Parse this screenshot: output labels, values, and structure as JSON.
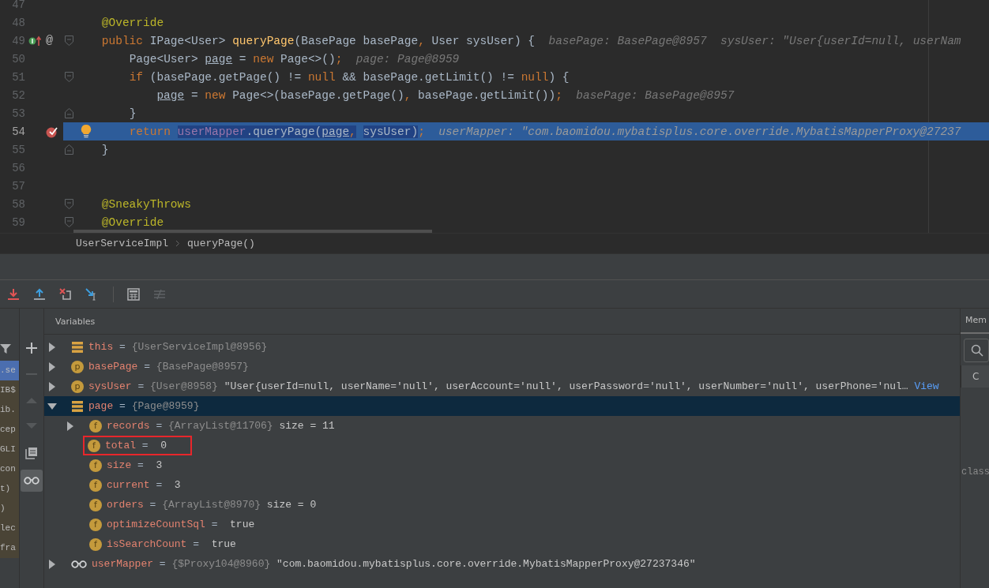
{
  "editor": {
    "lines": [
      {
        "number": "47",
        "current": false
      },
      {
        "number": "48",
        "current": false,
        "tokens": [
          {
            "t": "    @Override",
            "kind": "ann"
          }
        ]
      },
      {
        "number": "49",
        "current": false,
        "implements": true,
        "gutter_text": "@",
        "fold_start": true,
        "tokens": [
          {
            "t": "    public",
            "kind": "kw"
          },
          {
            "t": " IPage<User> ",
            "kind": "plain"
          },
          {
            "t": "queryPage",
            "kind": "fn"
          },
          {
            "t": "(BasePage basePage",
            "kind": "plain"
          },
          {
            "t": ",",
            "kind": "kw"
          },
          {
            "t": " User sysUser) {",
            "kind": "plain"
          },
          {
            "t": "basePage: BasePage@8957  sysUser: \"User{userId=null, userNam",
            "kind": "hint"
          }
        ]
      },
      {
        "number": "50",
        "current": false,
        "tokens": [
          {
            "t": "        Page<User> ",
            "kind": "plain"
          },
          {
            "t": "page",
            "kind": "var"
          },
          {
            "t": " = ",
            "kind": "plain"
          },
          {
            "t": "new",
            "kind": "kw"
          },
          {
            "t": " Page<>()",
            "kind": "plain"
          },
          {
            "t": ";",
            "kind": "kw"
          },
          {
            "t": "page: Page@8959",
            "kind": "hint"
          }
        ]
      },
      {
        "number": "51",
        "current": false,
        "fold_start": true,
        "tokens": [
          {
            "t": "        if",
            "kind": "kw"
          },
          {
            "t": " (basePage.getPage() != ",
            "kind": "plain"
          },
          {
            "t": "null",
            "kind": "kw"
          },
          {
            "t": " && basePage.getLimit() != ",
            "kind": "plain"
          },
          {
            "t": "null",
            "kind": "kw"
          },
          {
            "t": ") {",
            "kind": "plain"
          }
        ]
      },
      {
        "number": "52",
        "current": false,
        "tokens": [
          {
            "t": "            page",
            "kind": "var"
          },
          {
            "t": " = ",
            "kind": "plain"
          },
          {
            "t": "new",
            "kind": "kw"
          },
          {
            "t": " Page<>(basePage.getPage()",
            "kind": "plain"
          },
          {
            "t": ",",
            "kind": "kw"
          },
          {
            "t": " basePage.getLimit())",
            "kind": "plain"
          },
          {
            "t": ";",
            "kind": "kw"
          },
          {
            "t": "basePage: BasePage@8957",
            "kind": "hint"
          }
        ]
      },
      {
        "number": "53",
        "current": false,
        "fold_end": true,
        "tokens": [
          {
            "t": "        }",
            "kind": "plain"
          }
        ]
      },
      {
        "number": "54",
        "current": true,
        "breakpoint": true,
        "bulb": true,
        "tokens": [
          {
            "t": "        return",
            "kind": "kw",
            "selected": false
          },
          {
            "t": " userMapper",
            "kind": "field",
            "selected": true
          },
          {
            "t": ".queryPage(",
            "kind": "plain",
            "selected": true
          },
          {
            "t": "page",
            "kind": "var",
            "selected": true
          },
          {
            "t": ",",
            "kind": "kw",
            "selected": true
          },
          {
            "t": " sysUser)",
            "kind": "plain",
            "selected": true
          },
          {
            "t": ";",
            "kind": "kw",
            "selected": false
          },
          {
            "t": "userMapper: \"com.baomidou.mybatisplus.core.override.MybatisMapperProxy@27237",
            "kind": "hint",
            "selected": false
          }
        ]
      },
      {
        "number": "55",
        "current": false,
        "fold_end": true,
        "tokens": [
          {
            "t": "    }",
            "kind": "plain"
          }
        ]
      },
      {
        "number": "56",
        "current": false
      },
      {
        "number": "57",
        "current": false
      },
      {
        "number": "58",
        "current": false,
        "fold_start": true,
        "tokens": [
          {
            "t": "    @SneakyThrows",
            "kind": "ann"
          }
        ]
      },
      {
        "number": "59",
        "current": false,
        "fold_start": true,
        "tokens": [
          {
            "t": "    @Override",
            "kind": "ann"
          }
        ]
      }
    ]
  },
  "breadcrumb": [
    "UserServiceImpl",
    "queryPage()"
  ],
  "frames": [
    {
      "text": ".se",
      "selected": true
    },
    {
      "text": "IB$",
      "selected": false
    },
    {
      "text": "ib.",
      "selected": false
    },
    {
      "text": "cep",
      "selected": false
    },
    {
      "text": "GLI",
      "selected": false
    },
    {
      "text": "con",
      "selected": false
    },
    {
      "text": "t)",
      "selected": false
    },
    {
      "text": ")",
      "selected": false
    },
    {
      "text": "lec",
      "selected": false
    },
    {
      "text": "fra",
      "selected": false
    }
  ],
  "variables": {
    "title": "Variables",
    "items": [
      {
        "name": "this",
        "op": "=",
        "ref": "{UserServiceImpl@8956}",
        "kind": "static",
        "expanded": false,
        "selected": false,
        "highlighted": false
      },
      {
        "name": "basePage",
        "op": "=",
        "ref": "{BasePage@8957}",
        "kind": "param",
        "badge": "p",
        "expanded": false,
        "selected": false,
        "highlighted": false
      },
      {
        "name": "sysUser",
        "op": "=",
        "ref": "{User@8958}",
        "text": "\"User{userId=null, userName='null', userAccount='null', userPassword='null', userNumber='null', userPhone='nul…",
        "link": "View",
        "kind": "param",
        "badge": "p",
        "expanded": false,
        "selected": false,
        "highlighted": false
      },
      {
        "name": "page",
        "op": "=",
        "ref": "{Page@8959}",
        "kind": "static",
        "expanded": true,
        "selected": true,
        "highlighted": false,
        "children": [
          {
            "name": "records",
            "op": "=",
            "ref": "{ArrayList@11706}",
            "text": "size = 11",
            "kind": "field",
            "badge": "f",
            "expanded": false,
            "selected": false,
            "highlighted": false
          },
          {
            "name": "total",
            "op": "=",
            "text": "0",
            "kind": "field",
            "badge": "f",
            "selected": false,
            "highlighted": true
          },
          {
            "name": "size",
            "op": "=",
            "text": "3",
            "kind": "field",
            "badge": "f",
            "selected": false,
            "highlighted": false
          },
          {
            "name": "current",
            "op": "=",
            "text": "3",
            "kind": "field",
            "badge": "f",
            "selected": false,
            "highlighted": false
          },
          {
            "name": "orders",
            "op": "=",
            "ref": "{ArrayList@8970}",
            "text": "size = 0",
            "kind": "field",
            "badge": "f",
            "selected": false,
            "highlighted": false
          },
          {
            "name": "optimizeCountSql",
            "op": "=",
            "text": "true",
            "kind": "field",
            "badge": "f",
            "selected": false,
            "highlighted": false
          },
          {
            "name": "isSearchCount",
            "op": "=",
            "text": "true",
            "kind": "field",
            "badge": "f",
            "selected": false,
            "highlighted": false
          }
        ]
      },
      {
        "name": "userMapper",
        "op": "=",
        "ref": "{$Proxy104@8960}",
        "text": "\"com.baomidou.mybatisplus.core.override.MybatisMapperProxy@27237346\"",
        "kind": "watch",
        "expanded": false,
        "selected": false,
        "highlighted": false
      }
    ]
  },
  "memory": {
    "tab": "Mem",
    "column": "C",
    "row": "class"
  }
}
